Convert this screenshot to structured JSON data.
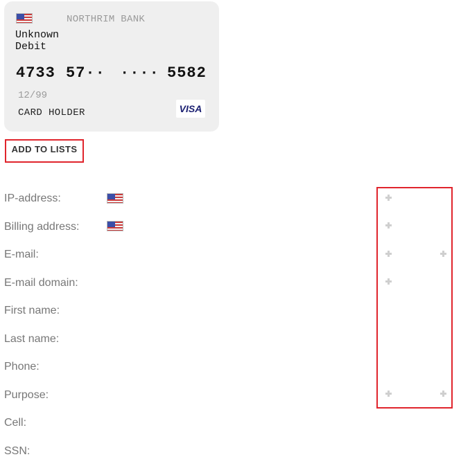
{
  "card": {
    "bank": "NORTHRIM BANK",
    "type_line1": "Unknown",
    "type_line2": "Debit",
    "number_groups": [
      "4733",
      "57··",
      "····",
      "5582"
    ],
    "expiry": "12/99",
    "holder": "CARD HOLDER",
    "network": "VISA",
    "flag_icon": "us-flag-icon"
  },
  "actions": {
    "add_to_lists": "ADD TO LISTS"
  },
  "fields": [
    {
      "label": "IP-address:",
      "flag": "us-flag-icon"
    },
    {
      "label": "Billing address:",
      "flag": "us-flag-icon"
    },
    {
      "label": "E-mail:"
    },
    {
      "label": "E-mail domain:"
    },
    {
      "label": "First name:"
    },
    {
      "label": "Last name:"
    },
    {
      "label": "Phone:"
    },
    {
      "label": "Purpose:"
    },
    {
      "label": "Cell:"
    },
    {
      "label": "SSN:"
    }
  ],
  "colors": {
    "highlight": "#e0242c",
    "card_bg": "#efefef",
    "label_text": "#777777"
  },
  "icons": {
    "add": "plus-icon"
  }
}
